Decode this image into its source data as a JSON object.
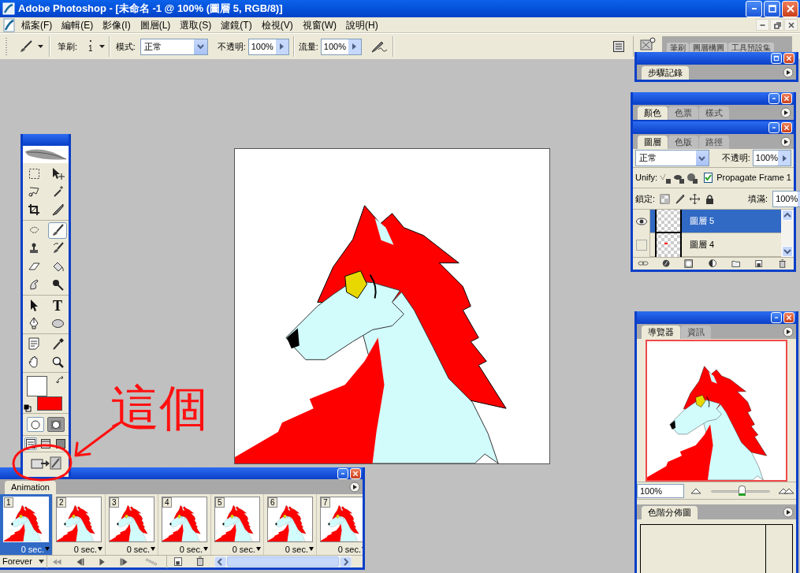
{
  "window": {
    "title": "Adobe Photoshop - [未命名 -1 @ 100% (圖層 5, RGB/8)]"
  },
  "menu": [
    "檔案(F)",
    "編輯(E)",
    "影像(I)",
    "圖層(L)",
    "選取(S)",
    "濾鏡(T)",
    "檢視(V)",
    "視窗(W)",
    "說明(H)"
  ],
  "options_bar": {
    "brush_label": "筆刷:",
    "brush_size": "1",
    "mode_label": "模式:",
    "mode": "正常",
    "opacity_label": "不透明:",
    "opacity": "100%",
    "flow_label": "流量:",
    "flow": "100%"
  },
  "palette_well": {
    "tabs": [
      "筆刷",
      "圖層構圖",
      "工具預設集"
    ]
  },
  "toolbox": {
    "tools": [
      {
        "kind": "marquee",
        "selected": false
      },
      {
        "kind": "move",
        "selected": false
      },
      {
        "kind": "lasso",
        "selected": false
      },
      {
        "kind": "wand",
        "selected": false
      },
      {
        "kind": "crop",
        "selected": false
      },
      {
        "kind": "slice",
        "selected": false
      },
      {
        "kind": "heal",
        "selected": false
      },
      {
        "kind": "brush",
        "selected": true
      },
      {
        "kind": "stamp",
        "selected": false
      },
      {
        "kind": "history_brush",
        "selected": false
      },
      {
        "kind": "eraser",
        "selected": false
      },
      {
        "kind": "bucket",
        "selected": false
      },
      {
        "kind": "smudge",
        "selected": false
      },
      {
        "kind": "burn",
        "selected": false
      },
      {
        "kind": "path_select",
        "selected": false
      },
      {
        "kind": "type",
        "glyph": "T",
        "selected": false
      },
      {
        "kind": "pen",
        "selected": false
      },
      {
        "kind": "ellipse",
        "selected": false
      },
      {
        "kind": "notes",
        "selected": false
      },
      {
        "kind": "eyedropper",
        "selected": false
      },
      {
        "kind": "hand",
        "selected": false
      },
      {
        "kind": "zoom",
        "selected": false
      }
    ],
    "swatches": [
      {
        "kind": "foreground",
        "color": "#ffffff"
      },
      {
        "kind": "background",
        "color": "#ff0000"
      }
    ],
    "mask_modes": [
      {
        "kind": "standard",
        "selected": true
      },
      {
        "kind": "quick_mask",
        "selected": false
      }
    ],
    "screen_modes": [
      {
        "kind": "standard",
        "selected": true
      },
      {
        "kind": "full_menu",
        "selected": false
      },
      {
        "kind": "full",
        "selected": false
      }
    ]
  },
  "history_panel": {
    "tabs": [
      {
        "label": "步驟記錄",
        "selected": true
      }
    ]
  },
  "color_panel": {
    "tabs": [
      {
        "label": "顏色",
        "selected": true
      },
      {
        "label": "色票",
        "selected": false
      },
      {
        "label": "樣式",
        "selected": false
      }
    ]
  },
  "layers_panel": {
    "tabs": [
      {
        "label": "圖層",
        "selected": true
      },
      {
        "label": "色版",
        "selected": false
      },
      {
        "label": "路徑",
        "selected": false
      }
    ],
    "blend_mode": "正常",
    "opacity_label": "不透明:",
    "opacity": "100%",
    "unify_label": "Unify:",
    "propagate": {
      "label": "Propagate Frame 1",
      "checked": true
    },
    "lock_label": "鎖定:",
    "fill_label": "填滿:",
    "fill": "100%",
    "layers": [
      {
        "name": "圖層 5",
        "visible": true,
        "selected": true
      },
      {
        "name": "圖層 4",
        "visible": false,
        "selected": false
      }
    ]
  },
  "navigator_panel": {
    "tabs": [
      {
        "label": "導覽器",
        "selected": true
      },
      {
        "label": "資訊",
        "selected": false
      }
    ],
    "zoom": "100%",
    "zoom_slider": {
      "level": 0.52
    }
  },
  "histogram_panel": {
    "tabs": [
      {
        "label": "色階分佈圖",
        "selected": true
      }
    ]
  },
  "animation_panel": {
    "tabs": [
      {
        "label": "Animation",
        "selected": true
      }
    ],
    "loop": "Forever",
    "frames": [
      {
        "number": "1",
        "delay": "0 sec.",
        "selected": true
      },
      {
        "number": "2",
        "delay": "0 sec.",
        "selected": false
      },
      {
        "number": "3",
        "delay": "0 sec.",
        "selected": false
      },
      {
        "number": "4",
        "delay": "0 sec.",
        "selected": false
      },
      {
        "number": "5",
        "delay": "0 sec.",
        "selected": false
      },
      {
        "number": "6",
        "delay": "0 sec.",
        "selected": false
      },
      {
        "number": "7",
        "delay": "0 sec.",
        "selected": false
      }
    ]
  },
  "annotation": {
    "text": "這個"
  }
}
